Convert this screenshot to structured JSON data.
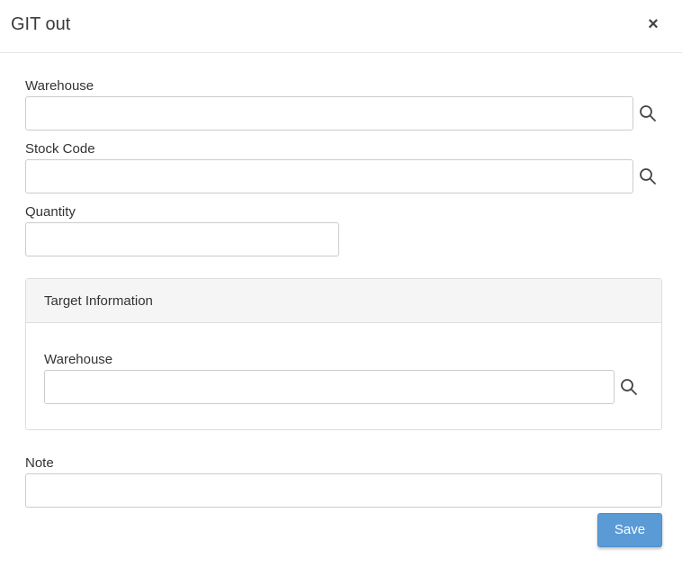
{
  "modal": {
    "title": "GIT out",
    "close_label": "×"
  },
  "form": {
    "warehouse_label": "Warehouse",
    "warehouse_value": "",
    "stock_code_label": "Stock Code",
    "stock_code_value": "",
    "quantity_label": "Quantity",
    "quantity_value": "",
    "target": {
      "heading": "Target Information",
      "warehouse_label": "Warehouse",
      "warehouse_value": ""
    },
    "note_label": "Note",
    "note_value": ""
  },
  "actions": {
    "save_label": "Save"
  },
  "icons": {
    "search": "search-icon",
    "close": "close-icon"
  },
  "colors": {
    "primary": "#5b9bd5",
    "border": "#cccccc",
    "panel_heading_bg": "#f5f5f5"
  }
}
